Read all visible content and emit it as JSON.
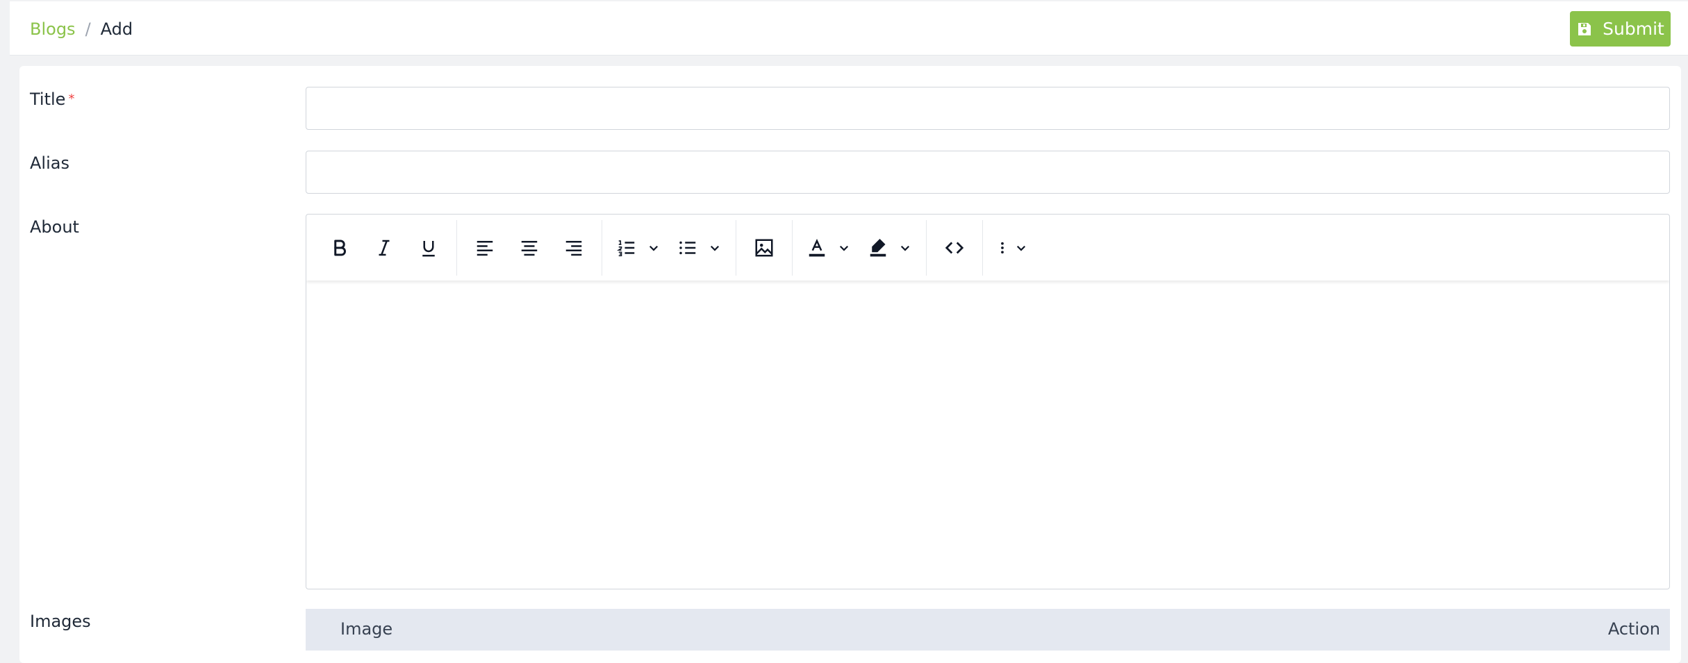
{
  "breadcrumb": {
    "parent": "Blogs",
    "separator": "/",
    "current": "Add"
  },
  "header": {
    "submit_label": "Submit",
    "submit_icon": "floppy-disk-icon"
  },
  "form": {
    "title": {
      "label": "Title",
      "required_mark": "*",
      "value": ""
    },
    "alias": {
      "label": "Alias",
      "value": ""
    },
    "about": {
      "label": "About",
      "value": ""
    },
    "images": {
      "label": "Images",
      "columns": [
        "Image",
        "Action"
      ]
    }
  },
  "editor_toolbar": [
    {
      "group": "text-style",
      "items": [
        "bold-icon",
        "italic-icon",
        "underline-icon"
      ]
    },
    {
      "group": "alignment",
      "items": [
        "align-left-icon",
        "align-center-icon",
        "align-right-icon"
      ]
    },
    {
      "group": "lists",
      "items": [
        "numbered-list-icon",
        "bulleted-list-icon"
      ]
    },
    {
      "group": "media",
      "items": [
        "image-icon"
      ]
    },
    {
      "group": "colors",
      "items": [
        "font-color-icon",
        "highlight-icon"
      ]
    },
    {
      "group": "code",
      "items": [
        "code-icon"
      ]
    },
    {
      "group": "more",
      "items": [
        "more-icon"
      ]
    }
  ],
  "colors": {
    "accent": "#8bc34a",
    "required": "#ef4444",
    "table_header": "#e4e8f0"
  }
}
